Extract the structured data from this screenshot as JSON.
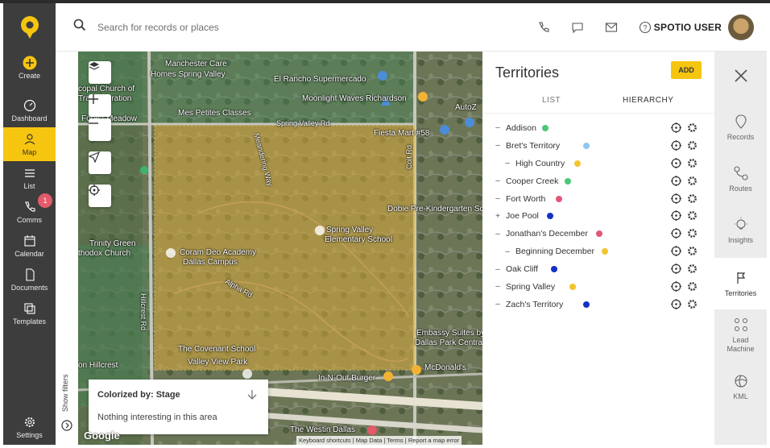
{
  "colors": {
    "brand": "#f6c510",
    "nav_bg": "#3d3d3d",
    "badge": "#e35a6a"
  },
  "nav": {
    "logo": "spotio-pin-logo",
    "items": [
      {
        "label": "Create",
        "icon": "plus-circle-icon"
      },
      {
        "label": "Dashboard",
        "icon": "gauge-icon"
      },
      {
        "label": "Map",
        "icon": "map-person-icon",
        "active": true
      },
      {
        "label": "List",
        "icon": "list-icon"
      },
      {
        "label": "Comms",
        "icon": "phone-icon",
        "badge": "1"
      },
      {
        "label": "Calendar",
        "icon": "calendar-icon"
      },
      {
        "label": "Documents",
        "icon": "documents-icon"
      },
      {
        "label": "Templates",
        "icon": "templates-icon"
      }
    ],
    "settings": "Settings"
  },
  "search": {
    "placeholder": "Search for records or places"
  },
  "user": {
    "name": "SPOTIO USER"
  },
  "map": {
    "layers_count": "5",
    "labels": [
      "Manchester Care",
      "Homes Spring Valley",
      "El Rancho Supermercado",
      "copal Church of",
      "Transfiguration",
      "Mes Petites Classes",
      "Moonlight Waves Richardson",
      "Spring Valley Rd",
      "Fiesta Mart #58",
      "Forest Meadow",
      "Dobie Pre-Kindergarten School",
      "Spring Valley",
      "Elementary School",
      "Coram Deo Academy",
      "Dallas Campus",
      "Trinity Green",
      "thodox Church",
      "The Covenant School",
      "Valley View Park",
      "In-N-Out Burger",
      "McDonald's",
      "Embassy Suites by Hilton",
      "Dallas Park Central",
      "The Westin Dallas",
      "Coit Rd",
      "Hillcrest Rd",
      "Meandering Way",
      "Alpha Rd",
      "on Hillcrest",
      "AutoZ"
    ],
    "colorized_title": "Colorized by: Stage",
    "colorized_msg": "Nothing interesting in this area",
    "show_filters": "Show filters",
    "attribution": [
      "Keyboard shortcuts",
      "Map Data",
      "Terms",
      "Report a map error"
    ],
    "google": "Google"
  },
  "panel": {
    "title": "Territories",
    "add_label": "ADD",
    "tabs": [
      "LIST",
      "HIERARCHY"
    ],
    "territories": [
      {
        "toggle": "–",
        "name": "Addison",
        "color": "#4cc77a",
        "indent": 0
      },
      {
        "toggle": "–",
        "name": "Bret's Territory",
        "color": "#8ec7ee",
        "indent": 0
      },
      {
        "toggle": "–",
        "name": "High Country",
        "color": "#f4c430",
        "indent": 1
      },
      {
        "toggle": "–",
        "name": "Cooper Creek",
        "color": "#4cc77a",
        "indent": 0
      },
      {
        "toggle": "–",
        "name": "Fort Worth",
        "color": "#e3567a",
        "indent": 0
      },
      {
        "toggle": "+",
        "name": "Joe Pool",
        "color": "#1330c9",
        "indent": 0
      },
      {
        "toggle": "–",
        "name": "Jonathan's December",
        "color": "#e3567a",
        "indent": 0
      },
      {
        "toggle": "–",
        "name": "Beginning December",
        "color": "#f4c430",
        "indent": 1
      },
      {
        "toggle": "–",
        "name": "Oak Cliff",
        "color": "#1330c9",
        "indent": 0
      },
      {
        "toggle": "–",
        "name": "Spring Valley",
        "color": "#f4c430",
        "indent": 0
      },
      {
        "toggle": "–",
        "name": "Zach's Territory",
        "color": "#1330c9",
        "indent": 0
      }
    ]
  },
  "rail": {
    "items": [
      {
        "label": "Records",
        "icon": "pin-outline-icon"
      },
      {
        "label": "Routes",
        "icon": "route-icon"
      },
      {
        "label": "Insights",
        "icon": "lightbulb-icon"
      },
      {
        "label": "Territories",
        "icon": "flag-icon",
        "active": true
      },
      {
        "label": "Lead Machine",
        "icon": "lead-machine-icon"
      },
      {
        "label": "KML",
        "icon": "globe-icon"
      }
    ]
  }
}
